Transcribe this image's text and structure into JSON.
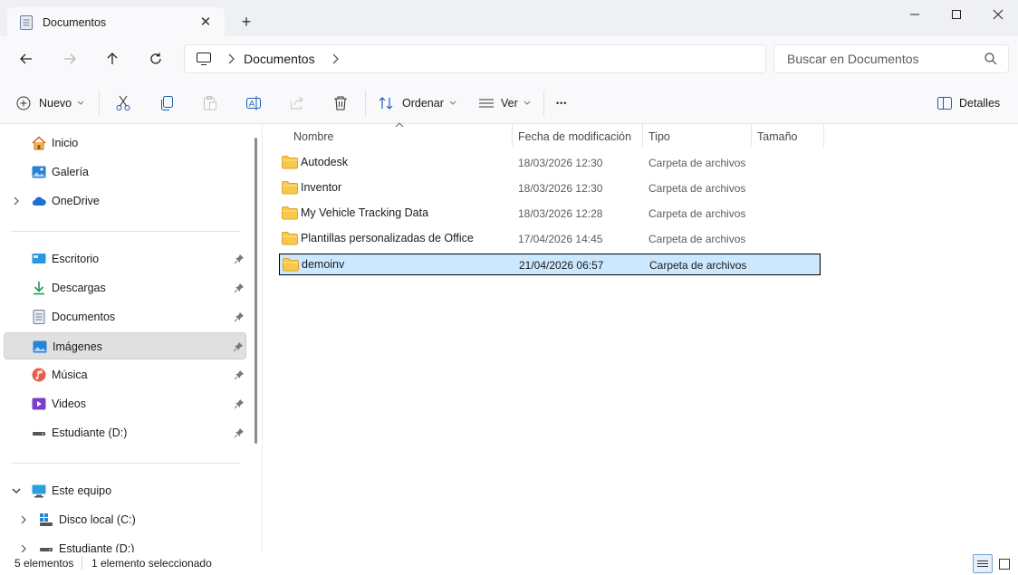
{
  "window": {
    "tab_title": "Documentos",
    "close_tab_glyph": "✕",
    "new_tab_glyph": "+"
  },
  "address_bar": {
    "breadcrumbs": [
      "Documentos"
    ],
    "search_placeholder": "Buscar en Documentos"
  },
  "toolbar": {
    "new_label": "Nuevo",
    "sort_label": "Ordenar",
    "view_label": "Ver",
    "more_glyph": "•••",
    "details_label": "Detalles"
  },
  "sidebar": {
    "top_items": [
      {
        "label": "Inicio",
        "icon": "home-icon"
      },
      {
        "label": "Galería",
        "icon": "gallery-icon"
      },
      {
        "label": "OneDrive",
        "icon": "onedrive-icon"
      }
    ],
    "quick_access": [
      {
        "label": "Escritorio",
        "icon": "desktop-icon"
      },
      {
        "label": "Descargas",
        "icon": "downloads-icon"
      },
      {
        "label": "Documentos",
        "icon": "documents-icon"
      },
      {
        "label": "Imágenes",
        "icon": "pictures-icon"
      },
      {
        "label": "Música",
        "icon": "music-icon"
      },
      {
        "label": "Videos",
        "icon": "videos-icon"
      },
      {
        "label": "Estudiante (D:)",
        "icon": "drive-icon"
      }
    ],
    "this_pc": {
      "label": "Este equipo",
      "icon": "this-pc-icon"
    },
    "drives": [
      {
        "label": "Disco local (C:)",
        "icon": "local-disk-icon"
      },
      {
        "label": "Estudiante (D:)",
        "icon": "drive-icon"
      }
    ]
  },
  "file_list": {
    "columns": [
      "Nombre",
      "Fecha de modificación",
      "Tipo",
      "Tamaño"
    ],
    "rows": [
      {
        "name": "Autodesk",
        "date": "18/03/2026 12:30",
        "type": "Carpeta de archivos"
      },
      {
        "name": "Inventor",
        "date": "18/03/2026 12:30",
        "type": "Carpeta de archivos"
      },
      {
        "name": "My Vehicle Tracking Data",
        "date": "18/03/2026 12:28",
        "type": "Carpeta de archivos"
      },
      {
        "name": "Plantillas personalizadas de Office",
        "date": "17/04/2026 14:45",
        "type": "Carpeta de archivos"
      },
      {
        "name": "demoinv",
        "date": "21/04/2026 06:57",
        "type": "Carpeta de archivos"
      }
    ]
  },
  "status_bar": {
    "item_count": "5 elementos",
    "selection": "1 elemento seleccionado"
  },
  "colors": {
    "accent": "#0067c0",
    "selection_bg": "#cce8ff",
    "folder": "#f8c84b"
  }
}
